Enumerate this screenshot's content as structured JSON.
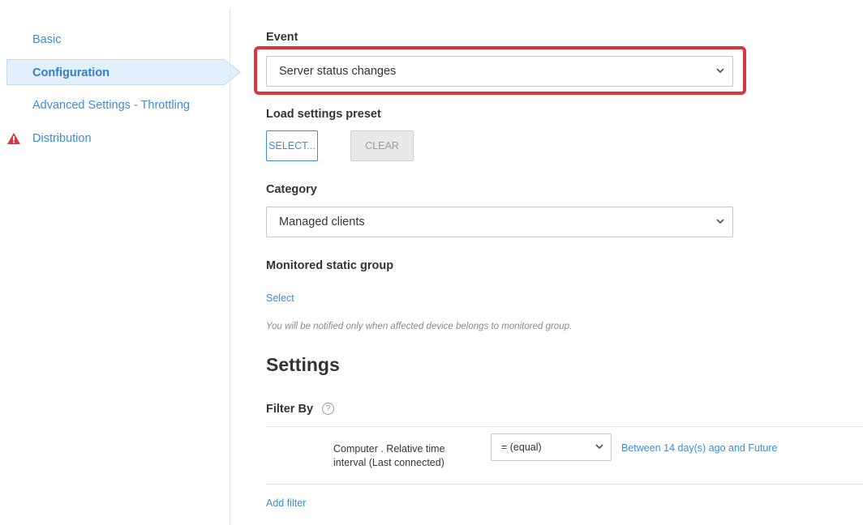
{
  "sidebar": {
    "items": [
      {
        "label": "Basic"
      },
      {
        "label": "Configuration"
      },
      {
        "label": "Advanced Settings - Throttling"
      },
      {
        "label": "Distribution"
      }
    ]
  },
  "event": {
    "label": "Event",
    "selected": "Server status changes"
  },
  "preset": {
    "label": "Load settings preset",
    "select_label": "SELECT...",
    "clear_label": "CLEAR"
  },
  "category": {
    "label": "Category",
    "selected": "Managed clients"
  },
  "monitored_group": {
    "label": "Monitored static group",
    "select_link": "Select",
    "hint": "You will be notified only when affected device belongs to monitored group."
  },
  "settings": {
    "title": "Settings",
    "filter_by_label": "Filter By",
    "help_glyph": "?",
    "filter": {
      "field": "Computer . Relative time interval (Last connected)",
      "operator": "= (equal)",
      "value": "Between 14 day(s) ago and Future"
    },
    "add_filter_link": "Add filter"
  },
  "colors": {
    "accent": "#3f8bd1",
    "highlight": "#d9363e",
    "warning": "#d9363e"
  },
  "icons": {
    "distribution": "warning-icon",
    "dropdown": "chevron-down-icon",
    "help": "help-circle-icon"
  }
}
